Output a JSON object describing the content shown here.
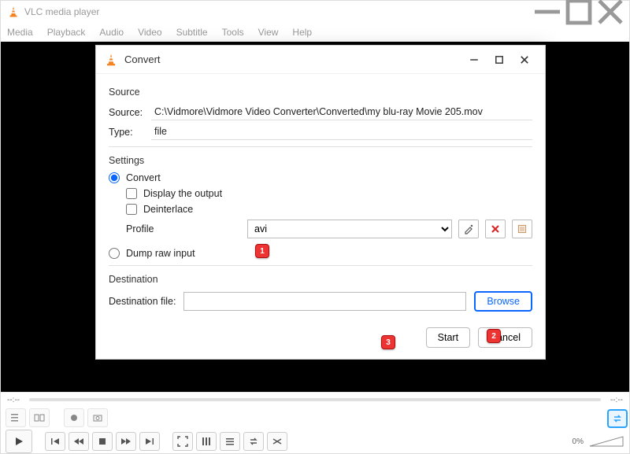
{
  "main": {
    "title": "VLC media player",
    "menu": [
      "Media",
      "Playback",
      "Audio",
      "Video",
      "Subtitle",
      "Tools",
      "View",
      "Help"
    ],
    "seek_left": "--:--",
    "seek_right": "--:--",
    "volume_pct": "0%"
  },
  "dialog": {
    "title": "Convert",
    "source_section": "Source",
    "source_label": "Source:",
    "source_value": "C:\\Vidmore\\Vidmore Video Converter\\Converted\\my blu-ray Movie 205.mov",
    "type_label": "Type:",
    "type_value": "file",
    "settings_section": "Settings",
    "convert_label": "Convert",
    "display_output_label": "Display the output",
    "deinterlace_label": "Deinterlace",
    "profile_label": "Profile",
    "profile_value": "avi",
    "dump_label": "Dump raw input",
    "destination_section": "Destination",
    "dest_file_label": "Destination file:",
    "dest_file_value": "",
    "browse_label": "Browse",
    "start_label": "Start",
    "cancel_label": "Cancel"
  },
  "callouts": {
    "c1": "1",
    "c2": "2",
    "c3": "3"
  }
}
